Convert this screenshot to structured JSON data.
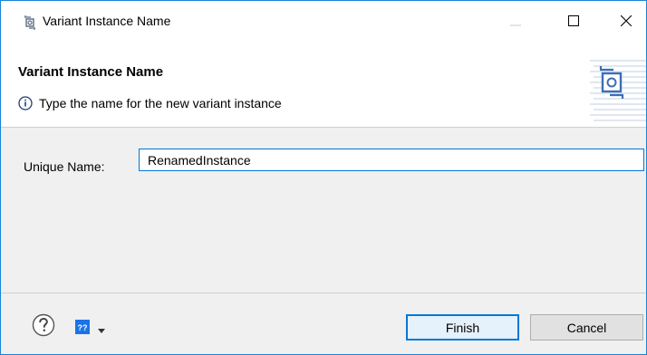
{
  "window": {
    "title": "Variant Instance Name",
    "minimize_icon": "minimize-icon",
    "maximize_icon": "maximize-icon",
    "close_icon": "close-icon"
  },
  "banner": {
    "title": "Variant Instance Name",
    "message": "Type the name for the new variant instance",
    "message_icon": "info-icon",
    "graphic_icon": "variant-instance-icon"
  },
  "form": {
    "unique_name_label": "Unique Name:",
    "unique_name_value": "RenamedInstance"
  },
  "footer": {
    "help_icon": "help-icon",
    "help_book_icon": "help-book-icon",
    "help_book_glyph": "??",
    "dropdown_icon": "dropdown-arrow-icon",
    "finish_label": "Finish",
    "cancel_label": "Cancel"
  },
  "colors": {
    "accent": "#0078d7",
    "window_border": "#1883d7",
    "dialog_bg": "#f0f0f0",
    "banner_bg": "#ffffff",
    "help_book_bg": "#1a73e8"
  }
}
